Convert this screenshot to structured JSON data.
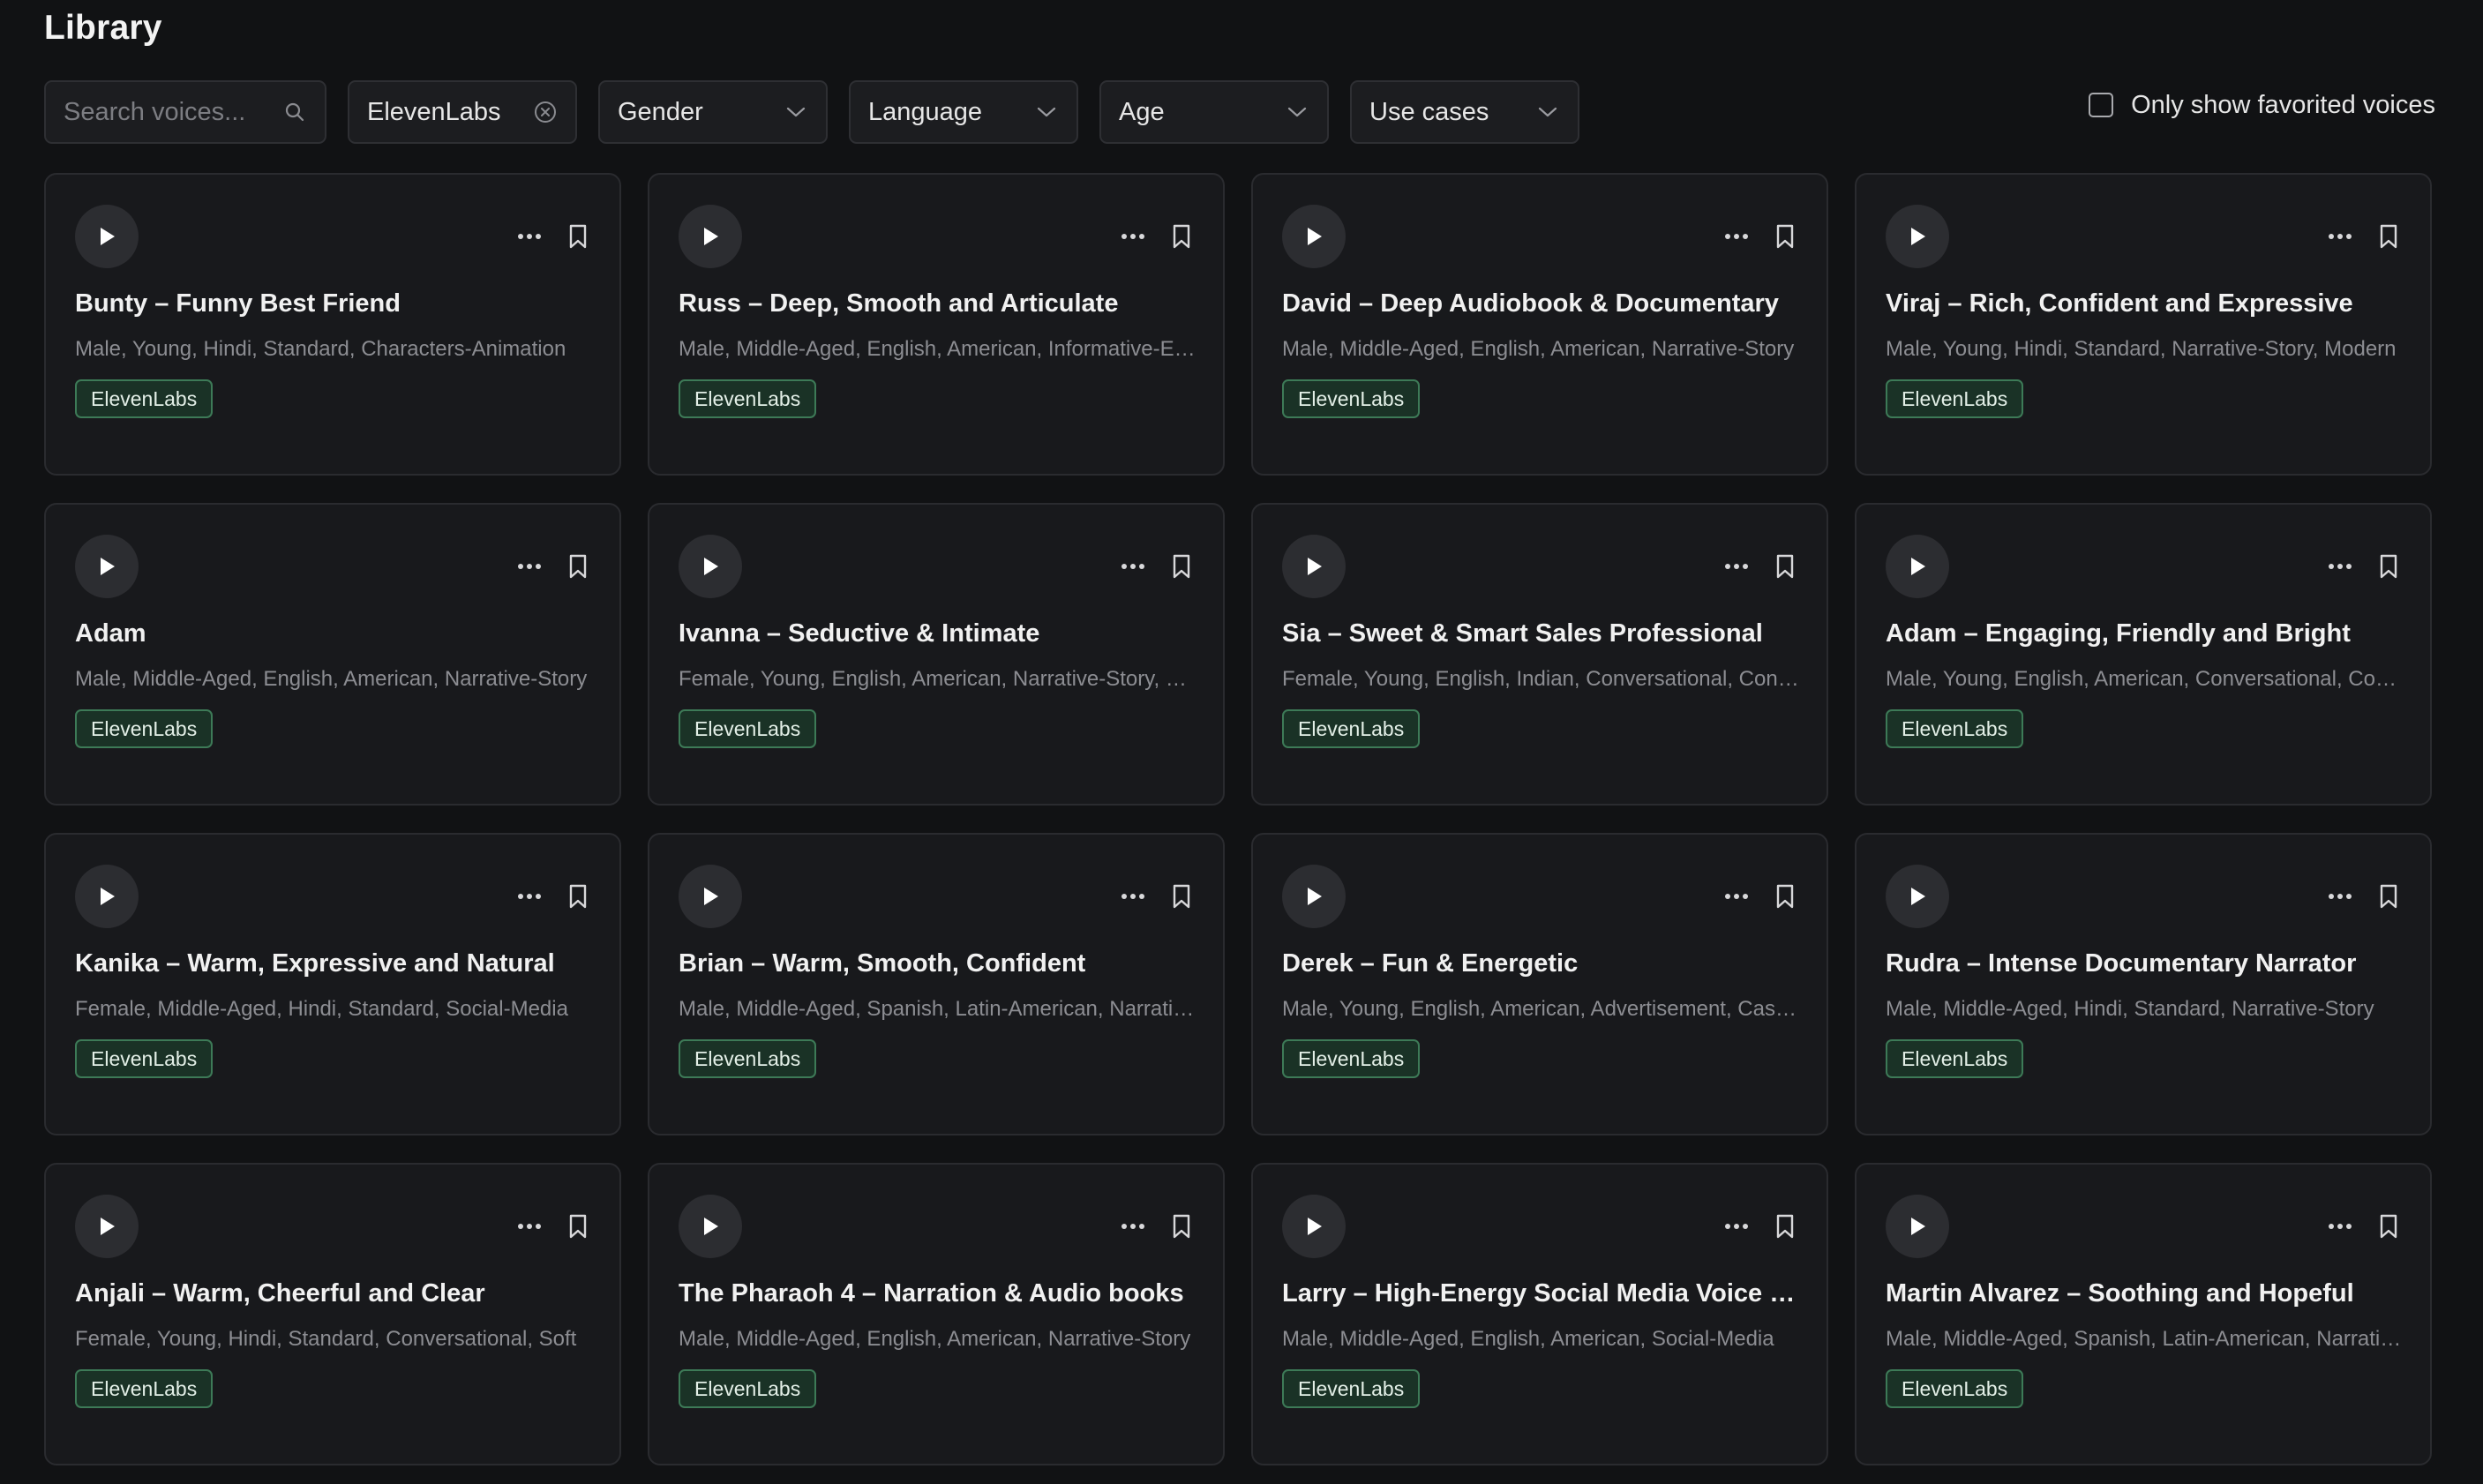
{
  "page": {
    "title": "Library"
  },
  "filters": {
    "search_placeholder": "Search voices...",
    "provider": "ElevenLabs",
    "gender": "Gender",
    "language": "Language",
    "age": "Age",
    "use_cases": "Use cases",
    "favorites_label": "Only show favorited voices",
    "favorites_checked": false
  },
  "voices": [
    {
      "name": "Bunty – Funny Best Friend",
      "desc": "Male, Young, Hindi, Standard, Characters-Animation",
      "tag": "ElevenLabs"
    },
    {
      "name": "Russ – Deep, Smooth and Articulate",
      "desc": "Male, Middle-Aged, English, American, Informative-Educational",
      "tag": "ElevenLabs"
    },
    {
      "name": "David – Deep Audiobook & Documentary",
      "desc": "Male, Middle-Aged, English, American, Narrative-Story",
      "tag": "ElevenLabs"
    },
    {
      "name": "Viraj – Rich, Confident and Expressive",
      "desc": "Male, Young, Hindi, Standard, Narrative-Story, Modern",
      "tag": "ElevenLabs"
    },
    {
      "name": "Adam",
      "desc": "Male, Middle-Aged, English, American, Narrative-Story",
      "tag": "ElevenLabs"
    },
    {
      "name": "Ivanna – Seductive & Intimate",
      "desc": "Female, Young, English, American, Narrative-Story, Soft",
      "tag": "ElevenLabs"
    },
    {
      "name": "Sia – Sweet & Smart Sales Professional",
      "desc": "Female, Young, English, Indian, Conversational, Confident",
      "tag": "ElevenLabs"
    },
    {
      "name": "Adam – Engaging, Friendly and Bright",
      "desc": "Male, Young, English, American, Conversational, Confident",
      "tag": "ElevenLabs"
    },
    {
      "name": "Kanika – Warm, Expressive and Natural",
      "desc": "Female, Middle-Aged, Hindi, Standard, Social-Media",
      "tag": "ElevenLabs"
    },
    {
      "name": "Brian – Warm, Smooth, Confident",
      "desc": "Male, Middle-Aged, Spanish, Latin-American, Narrative-Story",
      "tag": "ElevenLabs"
    },
    {
      "name": "Derek – Fun & Energetic",
      "desc": "Male, Young, English, American, Advertisement, Casual",
      "tag": "ElevenLabs"
    },
    {
      "name": "Rudra – Intense Documentary Narrator",
      "desc": "Male, Middle-Aged, Hindi, Standard, Narrative-Story",
      "tag": "ElevenLabs"
    },
    {
      "name": "Anjali – Warm, Cheerful and Clear",
      "desc": "Female, Young, Hindi, Standard, Conversational, Soft",
      "tag": "ElevenLabs"
    },
    {
      "name": "The Pharaoh 4 – Narration & Audio books",
      "desc": "Male, Middle-Aged, English, American, Narrative-Story",
      "tag": "ElevenLabs"
    },
    {
      "name": "Larry – High-Energy Social Media Voice for Ads",
      "desc": "Male, Middle-Aged, English, American, Social-Media",
      "tag": "ElevenLabs"
    },
    {
      "name": "Martin Alvarez – Soothing and Hopeful",
      "desc": "Male, Middle-Aged, Spanish, Latin-American, Narrative-Story",
      "tag": "ElevenLabs"
    }
  ]
}
